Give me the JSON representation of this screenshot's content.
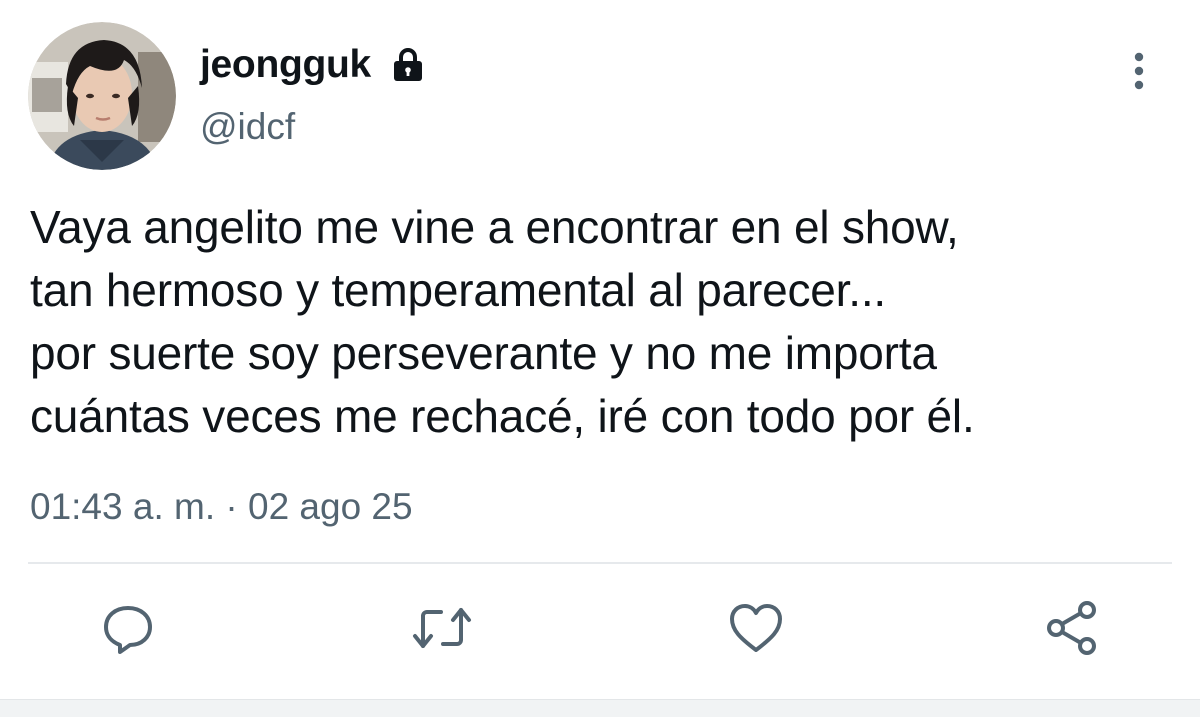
{
  "tweet": {
    "display_name": "jeongguk",
    "handle": "@idcf",
    "text_lines": [
      "Vaya angelito me vine a encontrar en el show,",
      "tan hermoso y temperamental al parecer...",
      "por suerte soy perseverante y no me importa",
      "cuántas veces me rechacé, iré con todo por él."
    ],
    "timestamp": "01:43 a. m. · 02 ago 25",
    "protected_account": true
  },
  "icons": {
    "avatar": "avatar",
    "lock": "lock-icon",
    "more": "more-vertical-icon",
    "reply": "reply-icon",
    "retweet": "retweet-icon",
    "like": "heart-icon",
    "share": "share-icon"
  },
  "colors": {
    "text_primary": "#0f1419",
    "text_secondary": "#536471",
    "icon": "#536471",
    "divider": "#e6e9ec"
  }
}
